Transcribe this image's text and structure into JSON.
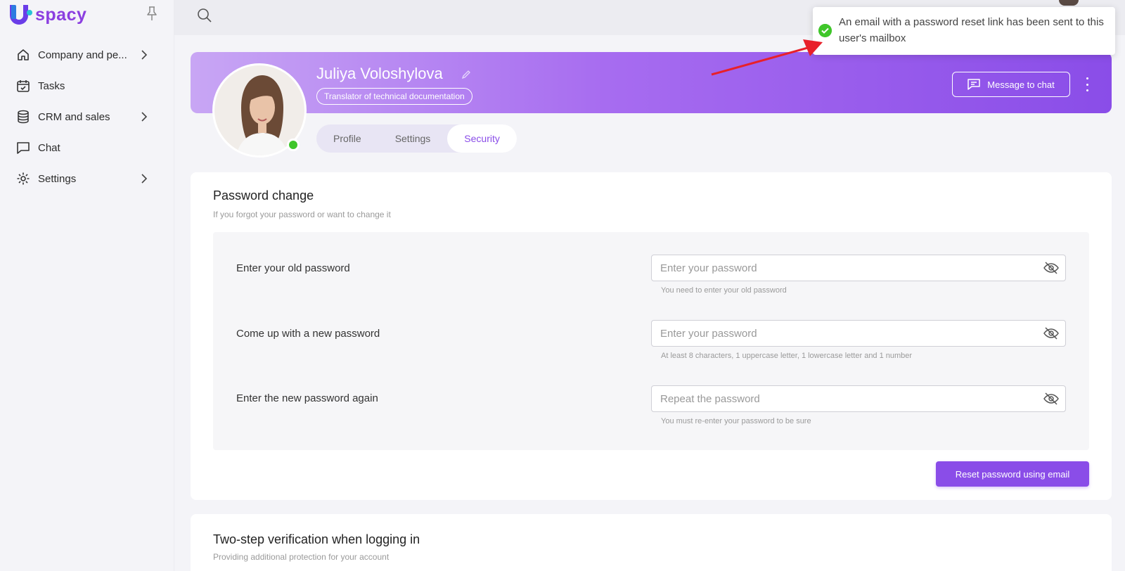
{
  "app": {
    "logo_text": "spacy"
  },
  "sidebar": {
    "items": [
      {
        "label": "Company and pe...",
        "icon": "home-icon",
        "has_chevron": true
      },
      {
        "label": "Tasks",
        "icon": "calendar-check-icon",
        "has_chevron": false
      },
      {
        "label": "CRM and sales",
        "icon": "database-icon",
        "has_chevron": true
      },
      {
        "label": "Chat",
        "icon": "chat-bubble-icon",
        "has_chevron": false
      },
      {
        "label": "Settings",
        "icon": "gear-icon",
        "has_chevron": true
      }
    ]
  },
  "profile": {
    "name": "Juliya Voloshylova",
    "role": "Translator of technical documentation",
    "message_button": "Message to chat",
    "tabs": [
      {
        "label": "Profile",
        "active": false
      },
      {
        "label": "Settings",
        "active": false
      },
      {
        "label": "Security",
        "active": true
      }
    ]
  },
  "password_change": {
    "title": "Password change",
    "subtitle": "If you forgot your password or want to change it",
    "fields": [
      {
        "label": "Enter your old password",
        "placeholder": "Enter your password",
        "hint": "You need to enter your old password"
      },
      {
        "label": "Come up with a new password",
        "placeholder": "Enter your password",
        "hint": "At least 8 characters, 1 uppercase letter, 1 lowercase letter and 1 number"
      },
      {
        "label": "Enter the new password again",
        "placeholder": "Repeat the password",
        "hint": "You must re-enter your password to be sure"
      }
    ],
    "reset_button": "Reset password using email"
  },
  "two_step": {
    "title": "Two-step verification when logging in",
    "subtitle": "Providing additional protection for your account"
  },
  "toast": {
    "message": "An email with a password reset link has been sent to this user's mailbox",
    "status_color": "#3fc62a"
  },
  "colors": {
    "accent": "#8a4de8",
    "success": "#3fc62a",
    "annotation_arrow": "#e8202a"
  }
}
